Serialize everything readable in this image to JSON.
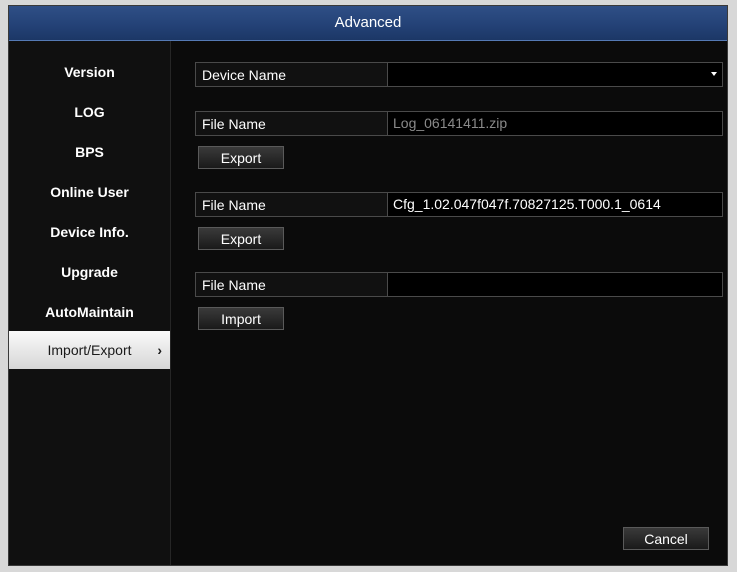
{
  "window": {
    "title": "Advanced"
  },
  "sidebar": {
    "items": [
      {
        "label": "Version"
      },
      {
        "label": "LOG"
      },
      {
        "label": "BPS"
      },
      {
        "label": "Online User"
      },
      {
        "label": "Device Info."
      },
      {
        "label": "Upgrade"
      },
      {
        "label": "AutoMaintain"
      },
      {
        "label": "Import/Export",
        "selected": true,
        "icon": "chevron-right-icon"
      }
    ]
  },
  "device": {
    "label": "Device Name",
    "value": ""
  },
  "log_export": {
    "label": "File Name",
    "value": "Log_06141411.zip",
    "button": "Export"
  },
  "config_export": {
    "label": "File Name",
    "value": "Cfg_1.02.047f047f.70827125.T000.1_0614",
    "button": "Export"
  },
  "config_import": {
    "label": "File Name",
    "value": "",
    "button": "Import"
  },
  "footer": {
    "cancel_label": "Cancel"
  },
  "colors": {
    "title_bar": "#244277",
    "background": "#0b0b0b",
    "selected_item": "#e8e8e8"
  }
}
